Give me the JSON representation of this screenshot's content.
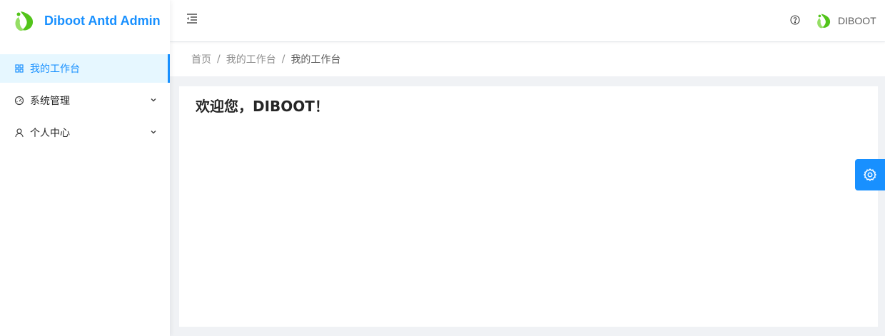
{
  "app": {
    "title": "Diboot Antd Admin",
    "brand_color": "#1890ff",
    "logo_color": "#52c41a"
  },
  "sidebar": {
    "items": [
      {
        "label": "我的工作台",
        "icon": "dashboard-grid-icon",
        "active": true
      },
      {
        "label": "系统管理",
        "icon": "gauge-icon",
        "expandable": true
      },
      {
        "label": "个人中心",
        "icon": "user-icon",
        "expandable": true
      }
    ]
  },
  "header": {
    "menu_toggle_icon": "menu-fold-icon",
    "help_icon": "question-circle-icon",
    "user_name": "DIBOOT"
  },
  "breadcrumb": {
    "items": [
      "首页",
      "我的工作台"
    ],
    "separator": "/",
    "current": "我的工作台"
  },
  "main": {
    "welcome": "欢迎您，DIBOOT！"
  },
  "settings": {
    "icon": "gear-icon"
  }
}
